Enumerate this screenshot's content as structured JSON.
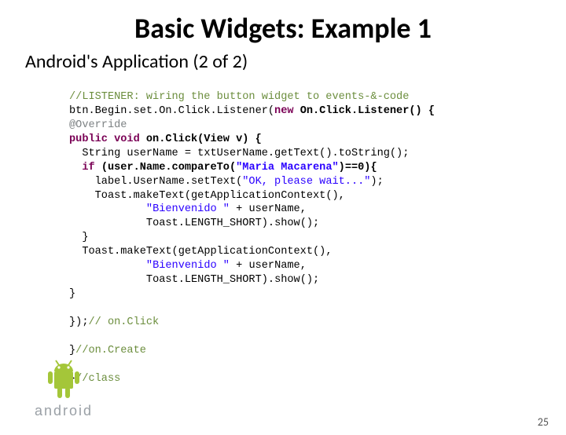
{
  "title": "Basic Widgets: Example 1",
  "subtitle": "Android's Application (2 of 2)",
  "code": {
    "l1": "//LISTENER: wiring the button widget to events-&-code",
    "l2a": "btn.Begin.set.On.Click.Listener(",
    "l2b": "new",
    "l2c": " On.Click.Listener() {",
    "l3": "@Override",
    "l4a": "public void",
    "l4b": " on.Click(View v) {",
    "l5": "String userName = txtUserName.getText().toString();",
    "l6a": "if",
    "l6b": " (user.Name.compareTo(",
    "l6c": "\"Maria Macarena\"",
    "l6d": ")==0){",
    "l7a": "label.UserName.setText(",
    "l7b": "\"OK, please wait...\"",
    "l7c": ");",
    "l8": "Toast.makeText(getApplicationContext(),",
    "l9a": "\"Bienvenido \"",
    "l9b": " + userName,",
    "l10a": "Toast.",
    "l10b": "LENGTH_SHORT",
    "l10c": ").show();",
    "l11": "}",
    "l12": "Toast.makeText(getApplicationContext(),",
    "l13a": "\"Bienvenido \"",
    "l13b": " + userName,",
    "l14a": "Toast.",
    "l14b": "LENGTH_SHORT",
    "l14c": ").show();",
    "l15": "}",
    "l16": "});",
    "l16c": "// on.Click",
    "l17": "}",
    "l17c": "//on.Create",
    "l18": "}",
    "l18c": "//class"
  },
  "page_number": "25",
  "brand": "android",
  "colors": {
    "comment": "#6c8e3e",
    "keyword": "#7a0055",
    "annotation": "#7d8284",
    "string": "#2a00ff",
    "android_green": "#a4c639"
  }
}
